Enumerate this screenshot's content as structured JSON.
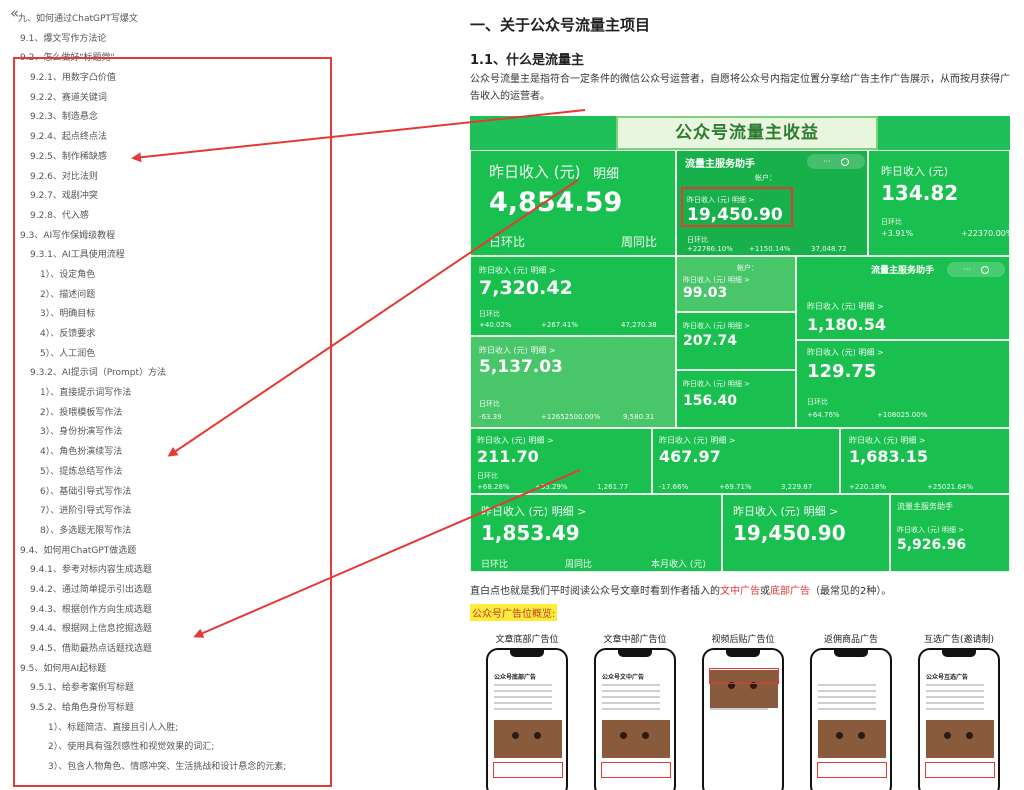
{
  "outline": {
    "collapse_icon": "«",
    "items": [
      {
        "label": "九、如何通过ChatGPT写爆文",
        "level": 1
      },
      {
        "label": "9.1、爆文写作方法论",
        "level": 2
      },
      {
        "label": "9.2、怎么做好\"标题党\"",
        "level": 2
      },
      {
        "label": "9.2.1、用数字凸价值",
        "level": 3
      },
      {
        "label": "9.2.2、赛道关键词",
        "level": 3
      },
      {
        "label": "9.2.3、制造悬念",
        "level": 3
      },
      {
        "label": "9.2.4、起点终点法",
        "level": 3
      },
      {
        "label": "9.2.5、制作稀缺感",
        "level": 3
      },
      {
        "label": "9.2.6、对比法则",
        "level": 3
      },
      {
        "label": "9.2.7、戏剧冲突",
        "level": 3
      },
      {
        "label": "9.2.8、代入感",
        "level": 3
      },
      {
        "label": "9.3、AI写作保姆级教程",
        "level": 2
      },
      {
        "label": "9.3.1、AI工具使用流程",
        "level": 3
      },
      {
        "label": "1）、设定角色",
        "level": 4
      },
      {
        "label": "2）、描述问题",
        "level": 4
      },
      {
        "label": "3）、明确目标",
        "level": 4
      },
      {
        "label": "4）、反馈要求",
        "level": 4
      },
      {
        "label": "5）、人工润色",
        "level": 4
      },
      {
        "label": "9.3.2、AI提示词（Prompt）方法",
        "level": 3
      },
      {
        "label": "1）、直接提示词写作法",
        "level": 4
      },
      {
        "label": "2）、投喂模板写作法",
        "level": 4
      },
      {
        "label": "3）、身份扮演写作法",
        "level": 4
      },
      {
        "label": "4）、角色扮演续写法",
        "level": 4
      },
      {
        "label": "5）、提炼总结写作法",
        "level": 4
      },
      {
        "label": "6）、基础引导式写作法",
        "level": 4
      },
      {
        "label": "7）、进阶引导式写作法",
        "level": 4
      },
      {
        "label": "8）、多选题无限写作法",
        "level": 4
      },
      {
        "label": "9.4、如何用ChatGPT做选题",
        "level": 2
      },
      {
        "label": "9.4.1、参考对标内容生成选题",
        "level": 3
      },
      {
        "label": "9.4.2、通过简单提示引出选题",
        "level": 3
      },
      {
        "label": "9.4.3、根据创作方向生成选题",
        "level": 3
      },
      {
        "label": "9.4.4、根据网上信息挖掘选题",
        "level": 3
      },
      {
        "label": "9.4.5、借助最热点话题找选题",
        "level": 3
      },
      {
        "label": "9.5、如何用AI起标题",
        "level": 2
      },
      {
        "label": "9.5.1、给参考案例写标题",
        "level": 3
      },
      {
        "label": "9.5.2、给角色身份写标题",
        "level": 3
      },
      {
        "label": "1）、标题简洁、直接且引人入胜;",
        "level": 5
      },
      {
        "label": "2）、使用具有强烈感性和视觉效果的词汇;",
        "level": 5
      },
      {
        "label": "3）、包含人物角色、情感冲突、生活挑战和设计悬念的元素;",
        "level": 5
      }
    ]
  },
  "content": {
    "h1": "一、关于公众号流量主项目",
    "h2": "1.1、什么是流量主",
    "para": "公众号流量主是指符合一定条件的微信公众号运营者，自愿将公众号内指定位置分享给广告主作广告展示，从而按月获得广告收入的运营者。",
    "banner": "公众号流量主收益",
    "para2_a": "直白点也就是我们平时阅读公众号文章时看到作者插入的",
    "para2_link1": "文中广告",
    "para2_or": "或",
    "para2_link2": "底部广告",
    "para2_b": "（最常见的2种）。",
    "highlight": "公众号广告位概览:"
  },
  "tiles": {
    "yesterday": "昨日收入 (元)",
    "detail": "明细",
    "detail_arrow": "明细 >",
    "day_ratio": "日环比",
    "week_ratio": "周同比",
    "month": "本月收入 (元)",
    "assistant": "流量主服务助手",
    "account": "帐户：",
    "yesterday_small": "昨日收入 (元)  明细 >",
    "t1_value": "4,854.59",
    "t2_value": "19,450.90",
    "t2_d": "+22786.10%",
    "t2_w": "+1150.14%",
    "t2_m": "37,048.72",
    "t3_value": "134.82",
    "t3_d": "+3.91%",
    "t3_w": "+22370.00%",
    "t4_value": "7,320.42",
    "t4_d": "+40.02%",
    "t4_w": "+267.41%",
    "t4_m": "47,270.38",
    "t5_value": "99.03",
    "t6_value": "1,180.54",
    "t7_value": "207.74",
    "t8_value": "129.75",
    "t8_d": "+64.76%",
    "t8_w": "+108025.00%",
    "t9_value": "5,137.03",
    "t9_d": "-63.39",
    "t9_w": "+12652500.00%",
    "t9_m": "9,580.31",
    "t10_value": "156.40",
    "t11_value": "211.70",
    "t11_d": "+68.28%",
    "t11_w": "+35.29%",
    "t11_m": "1,261.77",
    "t12_value": "467.97",
    "t12_d": "-17.66%",
    "t12_w": "+69.71%",
    "t12_m": "3,229.87",
    "t13_value": "1,683.15",
    "t13_d": "+220.18%",
    "t13_w": "+25021.64%",
    "t14_value": "1,853.49",
    "t15_value": "19,450.90",
    "t16_value": "5,926.96"
  },
  "phones": [
    {
      "caption": "文章底部广告位",
      "title": "公众号底部广告"
    },
    {
      "caption": "文章中部广告位",
      "title": "公众号文中广告"
    },
    {
      "caption": "视频后贴广告位",
      "title": ""
    },
    {
      "caption": "返佣商品广告",
      "title": ""
    },
    {
      "caption": "互选广告(邀请制)",
      "title": "公众号互选广告"
    }
  ],
  "colors": {
    "accent_red": "#e53935",
    "tile_green": "#19c04f",
    "highlight_yellow": "#ffeb3b"
  }
}
